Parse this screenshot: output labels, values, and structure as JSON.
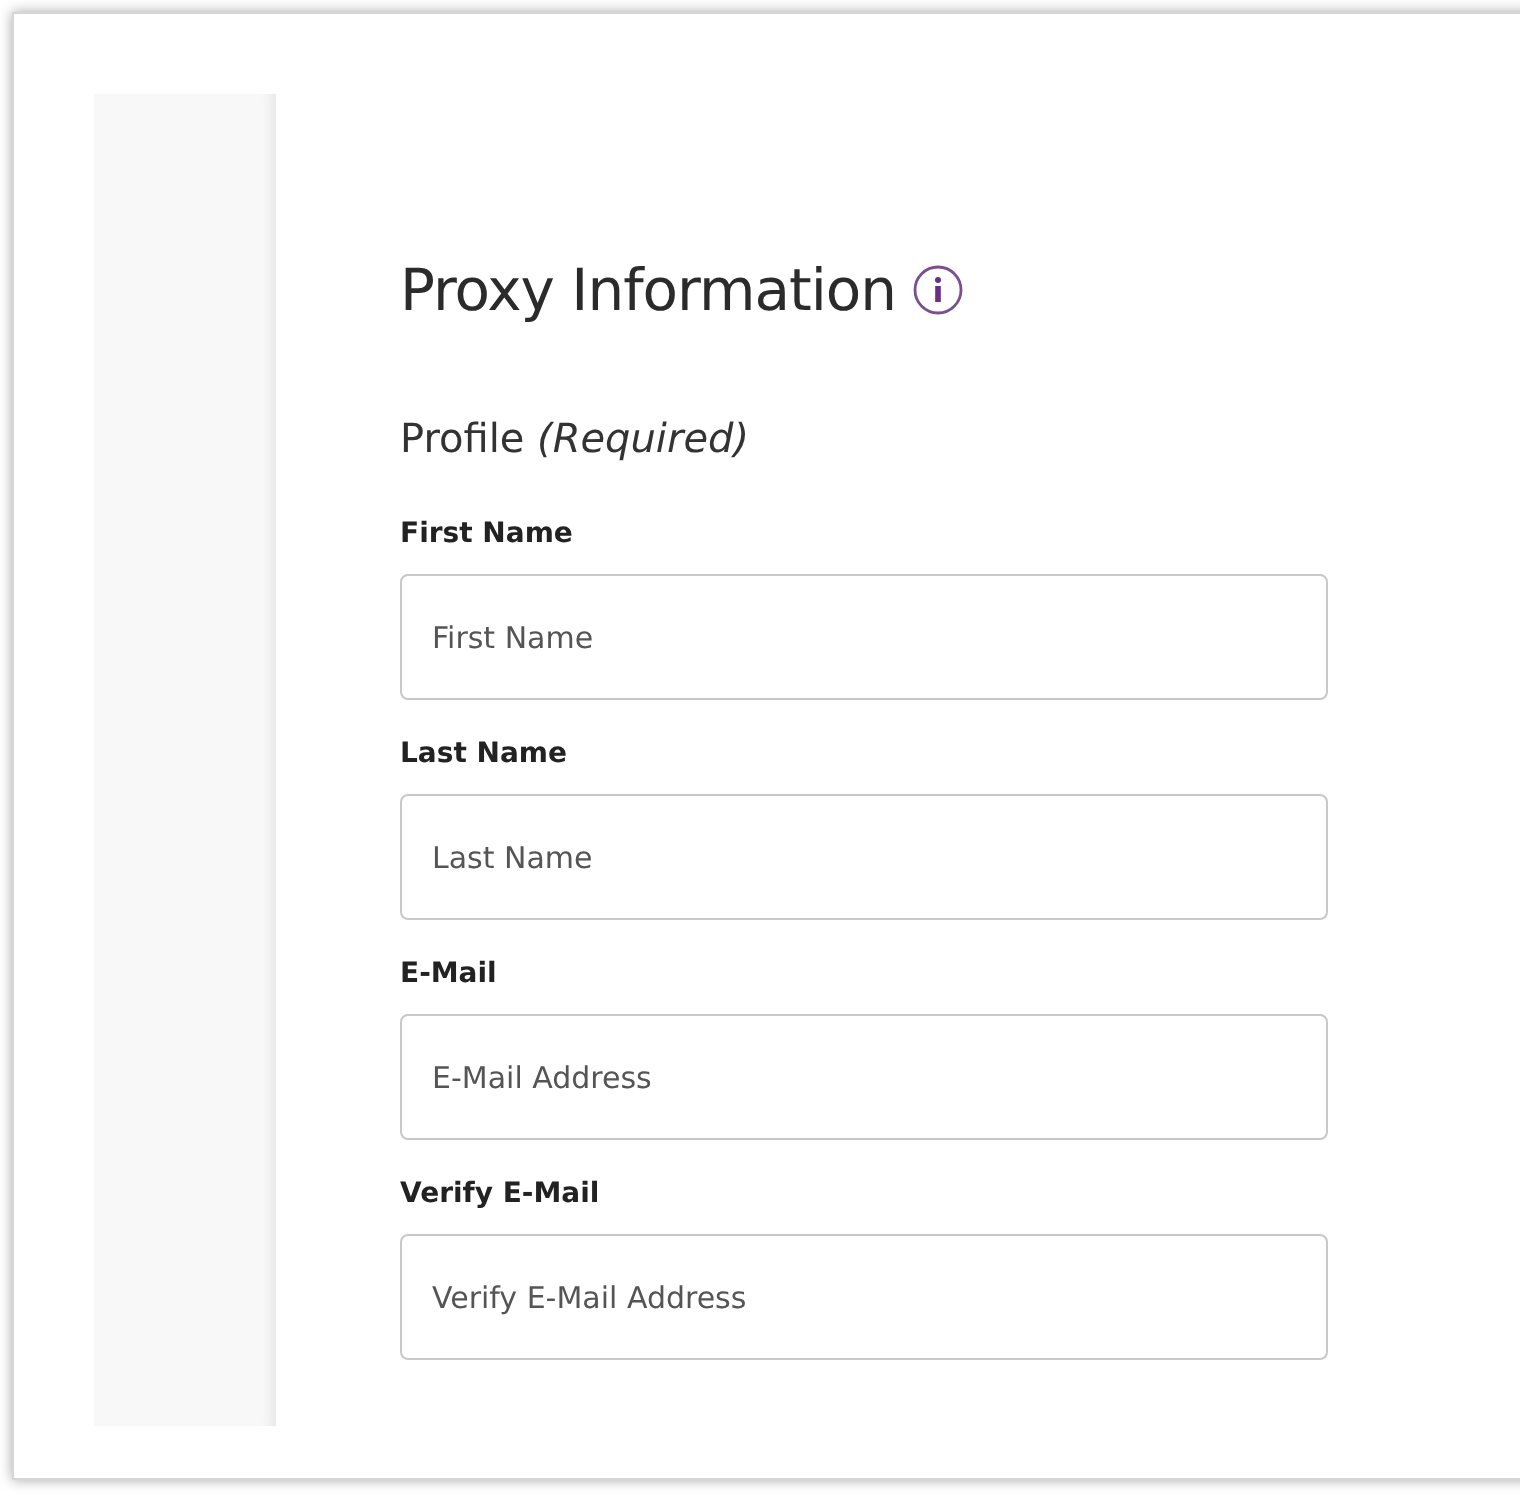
{
  "heading": {
    "title": "Proxy Information"
  },
  "section": {
    "title": "Profile *(Required)*"
  },
  "fields": [
    {
      "label": "First Name",
      "placeholder": "First Name"
    },
    {
      "label": "Last Name",
      "placeholder": "Last Name"
    },
    {
      "label": "E-Mail",
      "placeholder": "E-Mail Address"
    },
    {
      "label": "Verify E-Mail",
      "placeholder": "Verify E-Mail Address"
    }
  ]
}
